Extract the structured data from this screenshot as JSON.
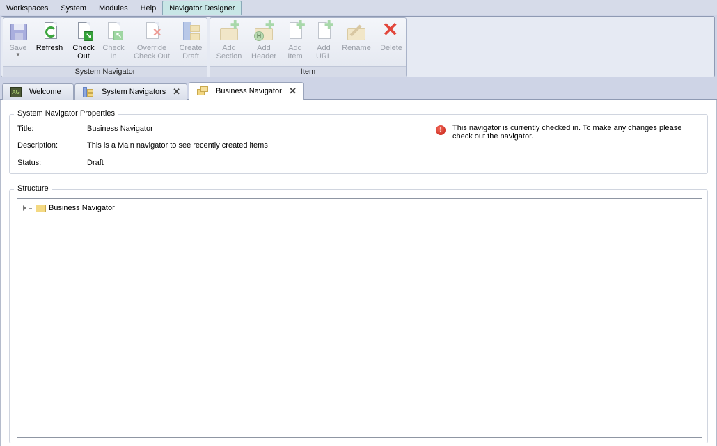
{
  "menu": {
    "items": [
      {
        "label": "Workspaces"
      },
      {
        "label": "System"
      },
      {
        "label": "Modules"
      },
      {
        "label": "Help"
      },
      {
        "label": "Navigator Designer"
      }
    ]
  },
  "ribbon": {
    "system_navigator": {
      "label": "System Navigator",
      "save": "Save",
      "refresh": "Refresh",
      "check_out": "Check\nOut",
      "check_in": "Check\nIn",
      "override_check_out": "Override\nCheck Out",
      "create_draft": "Create\nDraft"
    },
    "item": {
      "label": "Item",
      "add_section": "Add\nSection",
      "add_header": "Add\nHeader",
      "add_item": "Add\nItem",
      "add_url": "Add\nURL",
      "rename": "Rename",
      "delete": "Delete"
    }
  },
  "tabs": [
    {
      "label": "Welcome"
    },
    {
      "label": "System Navigators"
    },
    {
      "label": "Business Navigator"
    }
  ],
  "properties": {
    "legend": "System Navigator Properties",
    "title_label": "Title:",
    "title_value": "Business Navigator",
    "description_label": "Description:",
    "description_value": "This is a Main navigator to see recently created items",
    "status_label": "Status:",
    "status_value": "Draft",
    "warning": "This navigator is currently checked in. To make any changes please check out the navigator."
  },
  "structure": {
    "legend": "Structure",
    "root": "Business Navigator"
  },
  "colors": {
    "menubar": "#d6dbe9",
    "active_menu": "#c8e6e6",
    "refresh_green": "#3ca63f",
    "delete_red": "#e2463b",
    "warning_red": "#c31d12"
  }
}
